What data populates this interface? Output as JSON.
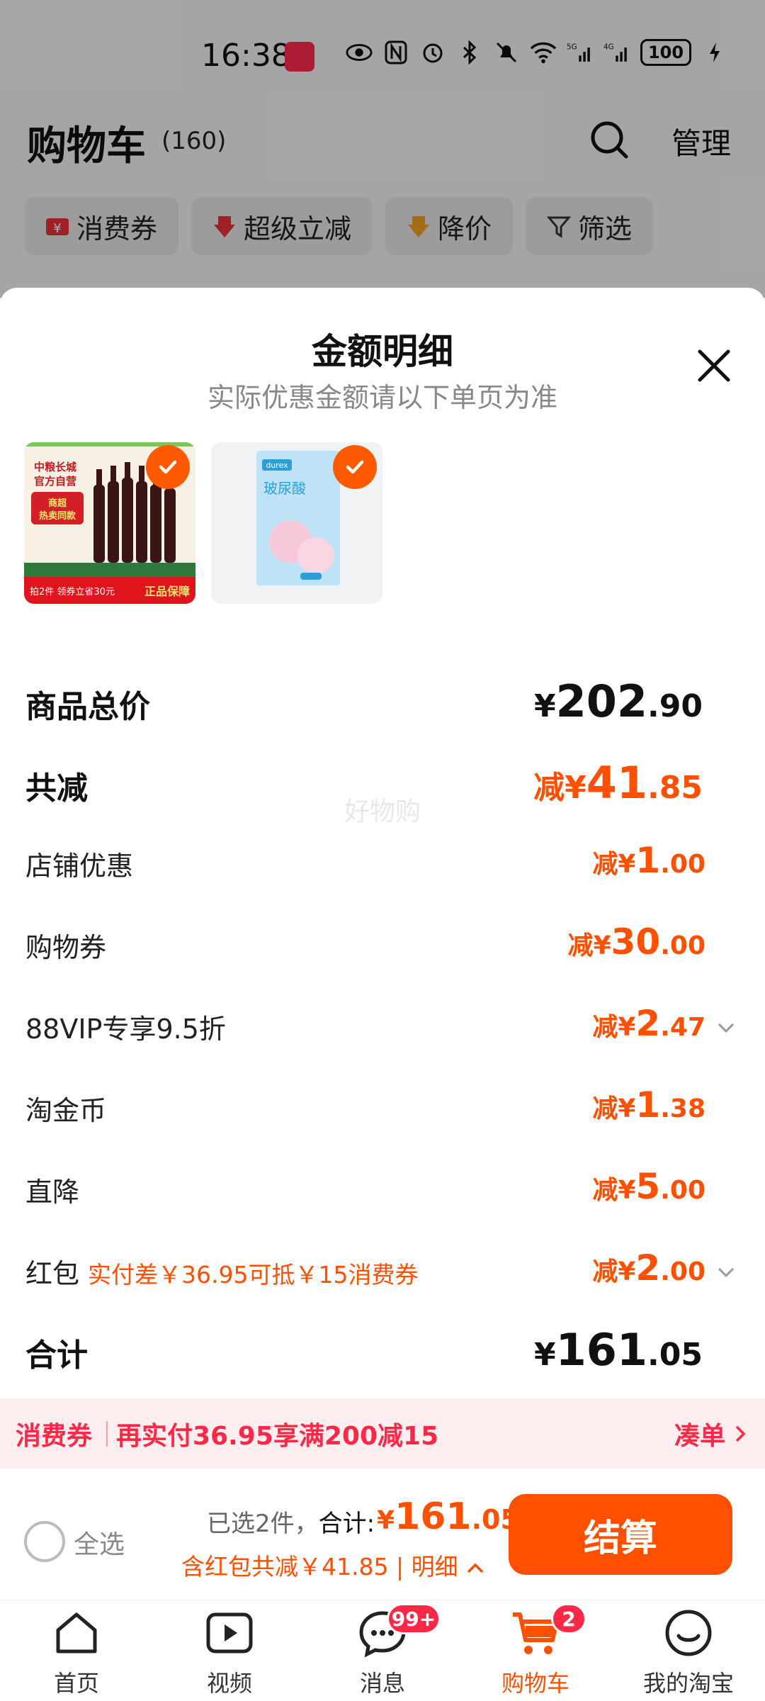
{
  "status_bar": {
    "time": "16:38",
    "battery": "100"
  },
  "header": {
    "title": "购物车",
    "count": "(160)",
    "manage_label": "管理"
  },
  "filters": [
    {
      "label": "消费券",
      "color": "#e8313a"
    },
    {
      "label": "超级立减",
      "color": "#e8313a"
    },
    {
      "label": "降价",
      "color": "#f0a020"
    },
    {
      "label": "筛选",
      "color": "#333333"
    }
  ],
  "sheet": {
    "title": "金额明细",
    "subtitle": "实际优惠金额请以下单页为准",
    "watermark": "好物购",
    "products": [
      {
        "name": "wine",
        "line1": "中粮长城",
        "line2": "官方自营",
        "tag": "商超热卖同款",
        "footer": "拍2件 领券立省30元",
        "guarantee": "正品保障"
      },
      {
        "name": "durex",
        "brand": "durex",
        "product": "玻尿酸"
      }
    ],
    "rows": [
      {
        "label": "商品总价",
        "prefix": "",
        "cur": "¥",
        "int": "202",
        "dec": ".90",
        "style": "total"
      },
      {
        "label": "共减",
        "prefix": "减",
        "cur": "¥",
        "int": "41",
        "dec": ".85",
        "style": "discount-big"
      },
      {
        "label": "店铺优惠",
        "prefix": "减",
        "cur": "¥",
        "int": "1",
        "dec": ".00",
        "style": "discount"
      },
      {
        "label": "购物券",
        "prefix": "减",
        "cur": "¥",
        "int": "30",
        "dec": ".00",
        "style": "discount"
      },
      {
        "label": "88VIP专享9.5折",
        "prefix": "减",
        "cur": "¥",
        "int": "2",
        "dec": ".47",
        "style": "discount",
        "expandable": true
      },
      {
        "label": "淘金币",
        "prefix": "减",
        "cur": "¥",
        "int": "1",
        "dec": ".38",
        "style": "discount"
      },
      {
        "label": "直降",
        "prefix": "减",
        "cur": "¥",
        "int": "5",
        "dec": ".00",
        "style": "discount"
      },
      {
        "label": "红包",
        "note": "实付差￥36.95可抵￥15消费券",
        "prefix": "减",
        "cur": "¥",
        "int": "2",
        "dec": ".00",
        "style": "discount",
        "expandable": true
      },
      {
        "label": "合计",
        "prefix": "",
        "cur": "¥",
        "int": "161",
        "dec": ".05",
        "style": "total"
      }
    ]
  },
  "promo": {
    "tag": "消费券",
    "text": "再实付36.95享满200减15",
    "link": "凑单"
  },
  "checkout": {
    "select_all": "全选",
    "selected_prefix": "已选2件，",
    "total_label": "合计:",
    "total_cur": "¥",
    "total_int": "161",
    "total_dec": ".05",
    "savings": "含红包共减￥41.85 | 明细",
    "pay_label": "结算"
  },
  "tabbar": [
    {
      "label": "首页",
      "icon": "home-icon"
    },
    {
      "label": "视频",
      "icon": "video-icon"
    },
    {
      "label": "消息",
      "icon": "message-icon",
      "badge": "99+"
    },
    {
      "label": "购物车",
      "icon": "cart-icon",
      "badge": "2",
      "active": true
    },
    {
      "label": "我的淘宝",
      "icon": "profile-icon"
    }
  ],
  "colors": {
    "accent": "#ff5000",
    "promo_red": "#ff2846"
  }
}
